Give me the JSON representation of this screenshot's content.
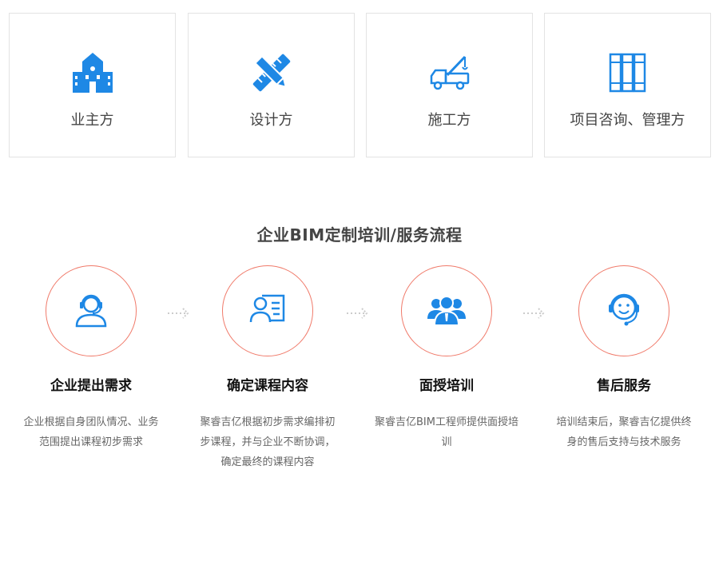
{
  "audience_cards": [
    {
      "label": "业主方",
      "icon": "building-icon"
    },
    {
      "label": "设计方",
      "icon": "pencil-ruler-icon"
    },
    {
      "label": "施工方",
      "icon": "crane-truck-icon"
    },
    {
      "label": "项目咨询、管理方",
      "icon": "books-icon"
    }
  ],
  "process": {
    "title": "企业BIM定制培训/服务流程",
    "steps": [
      {
        "title": "企业提出需求",
        "desc": "企业根据自身团队情况、业务范围提出课程初步需求",
        "icon": "headset-agent-icon"
      },
      {
        "title": "确定课程内容",
        "desc": "聚睿吉亿根据初步需求编排初步课程，并与企业不断协调，确定最终的课程内容",
        "icon": "profile-card-icon"
      },
      {
        "title": "面授培训",
        "desc": "聚睿吉亿BIM工程师提供面授培训",
        "icon": "group-people-icon"
      },
      {
        "title": "售后服务",
        "desc": "培训结束后，聚睿吉亿提供终身的售后支持与技术服务",
        "icon": "smile-headset-icon"
      }
    ]
  },
  "colors": {
    "icon_blue": "#1e88e5",
    "circle_border": "#f07a6a",
    "arrow_gray": "#cccccc"
  }
}
